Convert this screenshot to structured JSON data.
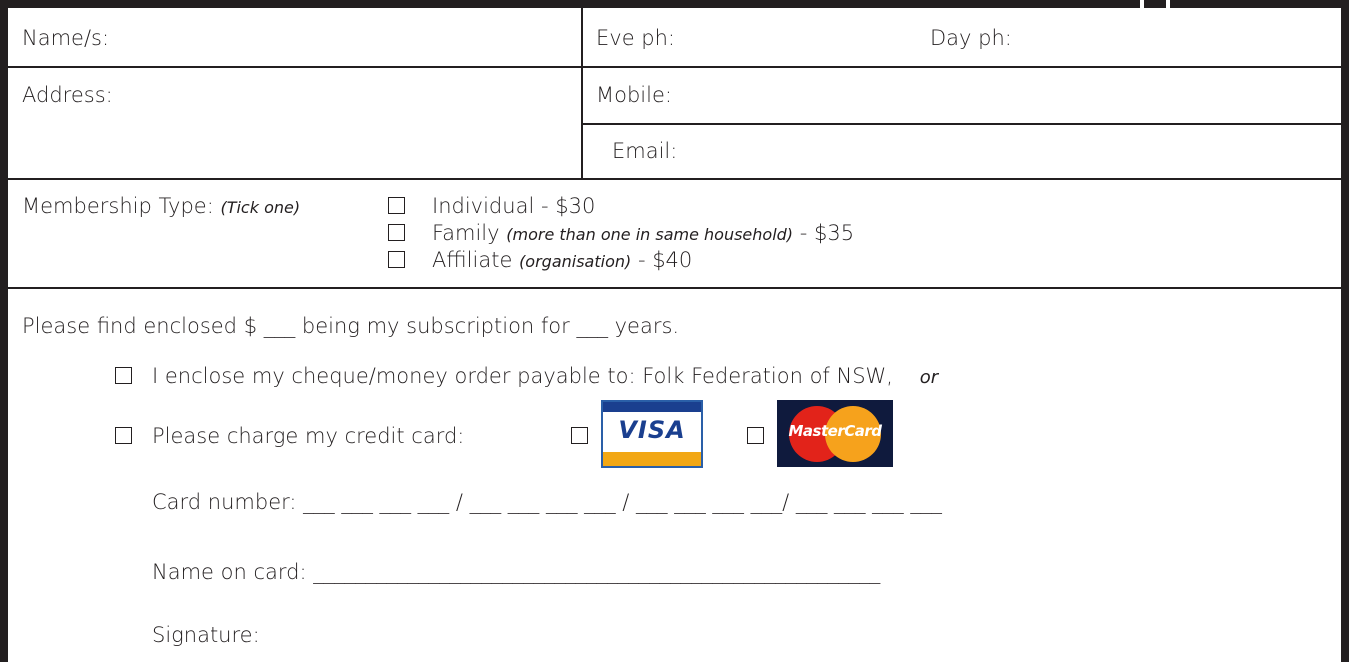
{
  "contact": {
    "names_label": "Name/s:",
    "eve_ph_label": "Eve ph:",
    "day_ph_label": "Day ph:",
    "address_label": "Address:",
    "mobile_label": "Mobile:",
    "email_label": "Email:"
  },
  "membership": {
    "label": "Membership Type:",
    "hint": "(Tick one)",
    "options": [
      {
        "name": "Individual",
        "note": "",
        "price": "- $30"
      },
      {
        "name": "Family",
        "note": "(more than one in same household)",
        "price": "- $35"
      },
      {
        "name": "Affiliate",
        "note": "(organisation)",
        "price": "- $40"
      }
    ]
  },
  "payment": {
    "enclosed_text": "Please find enclosed $ ___ being my subscription for ___ years.",
    "cheque_text": "I enclose my cheque/money order payable to: Folk Federation of NSW,",
    "cheque_or": "or",
    "credit_text": "Please charge my credit card:",
    "visa_logo_text": "VISA",
    "mastercard_logo_text": "MasterCard",
    "card_number_label": "Card number: ___ ___ ___ ___ / ___ ___ ___ ___ / ___ ___ ___ ___/ ___ ___ ___ ___",
    "name_on_card_label": "Name on card: ______________________________________________________",
    "signature_label": "Signature:"
  },
  "colors": {
    "ink": "#231f20",
    "visa_blue": "#1a3f8f",
    "visa_gold": "#f2a714",
    "mc_red": "#e2231a",
    "mc_yellow": "#f6a21c"
  }
}
